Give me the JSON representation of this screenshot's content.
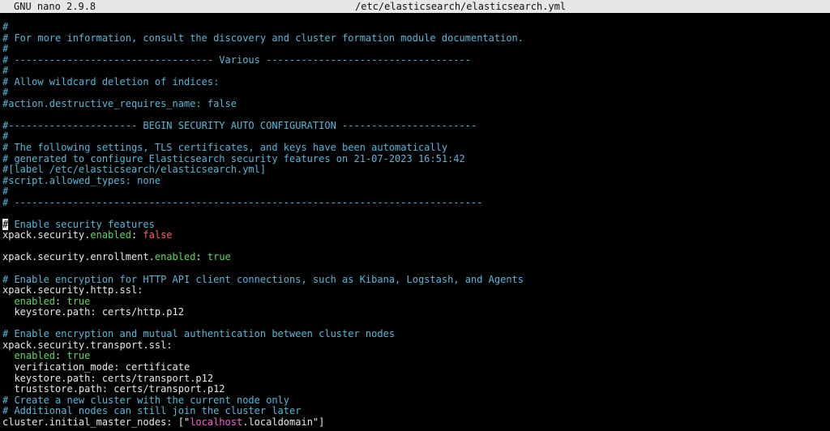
{
  "titlebar": {
    "app": "GNU nano 2.9.8",
    "file": "/etc/elasticsearch/elasticsearch.yml"
  },
  "lines": [
    [
      {
        "t": "#",
        "c": "comment"
      }
    ],
    [
      {
        "t": "# For more information, consult the discovery and cluster formation module documentation.",
        "c": "comment"
      }
    ],
    [
      {
        "t": "#",
        "c": "comment"
      }
    ],
    [
      {
        "t": "# ---------------------------------- Various -----------------------------------",
        "c": "comment"
      }
    ],
    [
      {
        "t": "#",
        "c": "comment"
      }
    ],
    [
      {
        "t": "# Allow wildcard deletion of indices:",
        "c": "comment"
      }
    ],
    [
      {
        "t": "#",
        "c": "comment"
      }
    ],
    [
      {
        "t": "#action.destructive_requires_name: false",
        "c": "comment"
      }
    ],
    [],
    [
      {
        "t": "#---------------------- BEGIN SECURITY AUTO CONFIGURATION -----------------------",
        "c": "comment"
      }
    ],
    [
      {
        "t": "#",
        "c": "comment"
      }
    ],
    [
      {
        "t": "# The following settings, TLS certificates, and keys have been automatically",
        "c": "comment"
      }
    ],
    [
      {
        "t": "# generated to configure Elasticsearch security features on 21-07-2023 16:51:42",
        "c": "comment"
      }
    ],
    [
      {
        "t": "#[label /etc/elasticsearch/elasticsearch.yml]",
        "c": "comment"
      }
    ],
    [
      {
        "t": "#script.allowed_types: none",
        "c": "comment"
      }
    ],
    [
      {
        "t": "#",
        "c": "comment"
      }
    ],
    [
      {
        "t": "# --------------------------------------------------------------------------------",
        "c": "comment"
      }
    ],
    [],
    [
      {
        "t": "#",
        "c": "cursor"
      },
      {
        "t": " Enable security features",
        "c": "comment"
      }
    ],
    [
      {
        "t": "xpack.security.",
        "c": "text"
      },
      {
        "t": "enabled",
        "c": "green"
      },
      {
        "t": ": ",
        "c": "text"
      },
      {
        "t": "false",
        "c": "red"
      }
    ],
    [],
    [
      {
        "t": "xpack.security.enrollment.",
        "c": "text"
      },
      {
        "t": "enabled",
        "c": "green"
      },
      {
        "t": ": ",
        "c": "text"
      },
      {
        "t": "true",
        "c": "green"
      }
    ],
    [],
    [
      {
        "t": "# Enable encryption for HTTP API client connections, such as Kibana, Logstash, and Agents",
        "c": "comment"
      }
    ],
    [
      {
        "t": "xpack.security.http.ssl:",
        "c": "text"
      }
    ],
    [
      {
        "t": "  ",
        "c": "text"
      },
      {
        "t": "enabled",
        "c": "green"
      },
      {
        "t": ": ",
        "c": "text"
      },
      {
        "t": "true",
        "c": "green"
      }
    ],
    [
      {
        "t": "  keystore.path: certs/http.p12",
        "c": "text"
      }
    ],
    [],
    [
      {
        "t": "# Enable encryption and mutual authentication between cluster nodes",
        "c": "comment"
      }
    ],
    [
      {
        "t": "xpack.security.transport.ssl:",
        "c": "text"
      }
    ],
    [
      {
        "t": "  ",
        "c": "text"
      },
      {
        "t": "enabled",
        "c": "green"
      },
      {
        "t": ": ",
        "c": "text"
      },
      {
        "t": "true",
        "c": "green"
      }
    ],
    [
      {
        "t": "  verification_mode: certificate",
        "c": "text"
      }
    ],
    [
      {
        "t": "  keystore.path: certs/transport.p12",
        "c": "text"
      }
    ],
    [
      {
        "t": "  truststore.path: certs/transport.p12",
        "c": "text"
      }
    ],
    [
      {
        "t": "# Create a new cluster with the current node only",
        "c": "comment"
      }
    ],
    [
      {
        "t": "# Additional nodes can still join the cluster later",
        "c": "comment"
      }
    ],
    [
      {
        "t": "cluster.initial_master_nodes: [\"",
        "c": "text"
      },
      {
        "t": "localhost",
        "c": "magenta"
      },
      {
        "t": ".localdomain\"]",
        "c": "text"
      }
    ]
  ]
}
